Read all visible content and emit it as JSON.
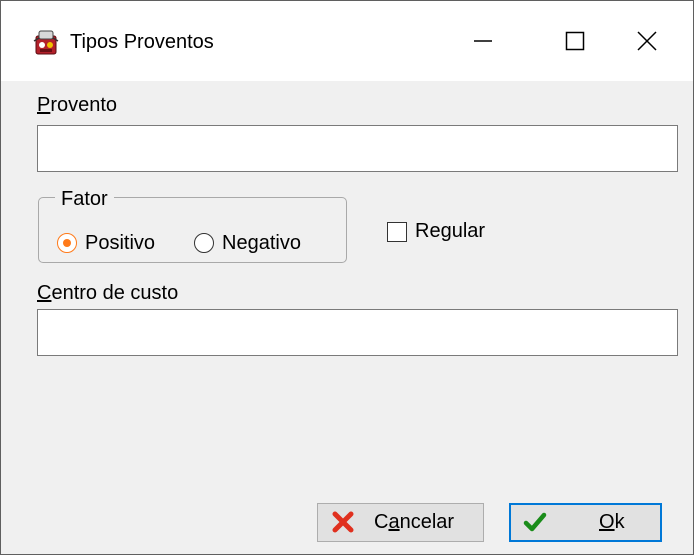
{
  "window": {
    "title": "Tipos Proventos",
    "app_icon": "app-icon"
  },
  "title_bar_buttons": {
    "minimize_icon": "minimize-icon",
    "maximize_icon": "maximize-icon",
    "close_icon": "close-icon"
  },
  "form": {
    "provento": {
      "label_first": "P",
      "label_rest": "rovento",
      "value": ""
    },
    "fator": {
      "title": "Fator",
      "options": [
        {
          "label_before": "",
          "label_underline": "",
          "label_after": "Positivo",
          "checked": true
        },
        {
          "label_before": "Ne",
          "label_underline": "g",
          "label_after": "ativo",
          "checked": false
        }
      ]
    },
    "regular": {
      "label": "Regular",
      "checked": false
    },
    "centro_de_custo": {
      "label_first": "C",
      "label_rest": "entro de custo",
      "value": ""
    }
  },
  "buttons": {
    "cancel": {
      "label_before": "C",
      "label_underline": "a",
      "label_after": "ncelar",
      "icon": "x-icon",
      "icon_color": "#e0301e"
    },
    "ok": {
      "label_underline": "O",
      "label_after": "k",
      "icon": "check-icon",
      "icon_color": "#1a8c1a",
      "is_default": true
    }
  },
  "colors": {
    "accent": "#0078d7",
    "radio_selected": "#ff7a1a"
  }
}
